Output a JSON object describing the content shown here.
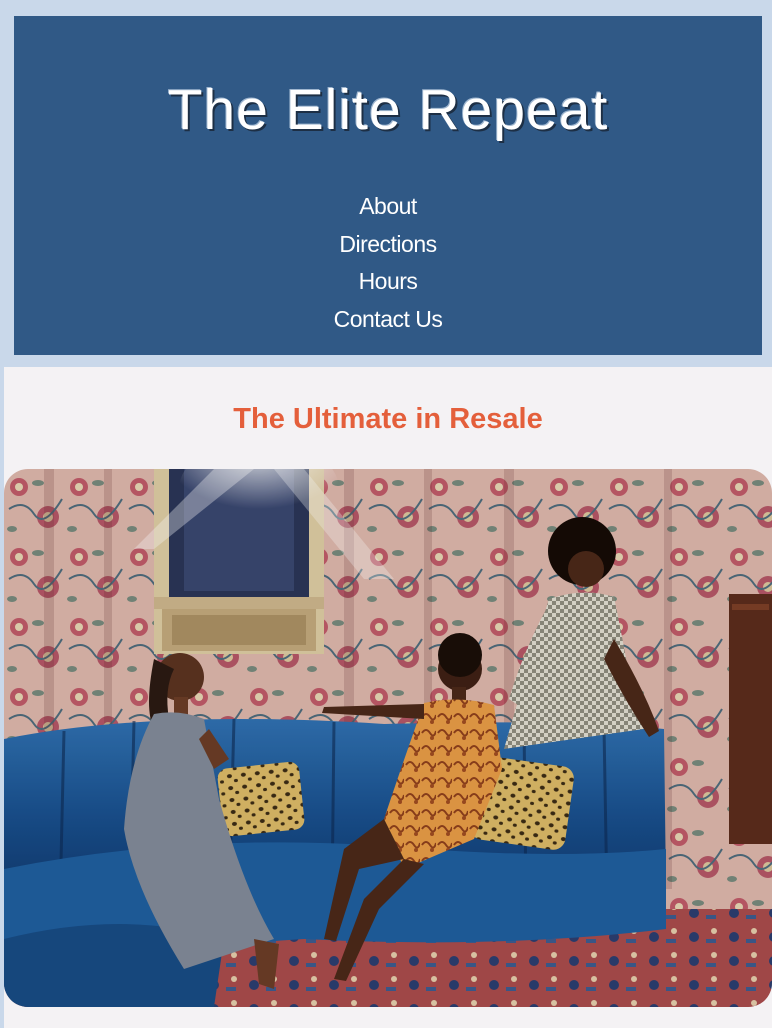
{
  "header": {
    "title": "The Elite Repeat",
    "nav": [
      {
        "label": "About"
      },
      {
        "label": "Directions"
      },
      {
        "label": "Hours"
      },
      {
        "label": "Contact Us"
      }
    ]
  },
  "main": {
    "tagline": "The Ultimate in Resale"
  },
  "colors": {
    "header_bg": "#305986",
    "frame": "#c9d8ea",
    "tagline": "#e45f3b",
    "page_bg": "#f4f2f4"
  }
}
